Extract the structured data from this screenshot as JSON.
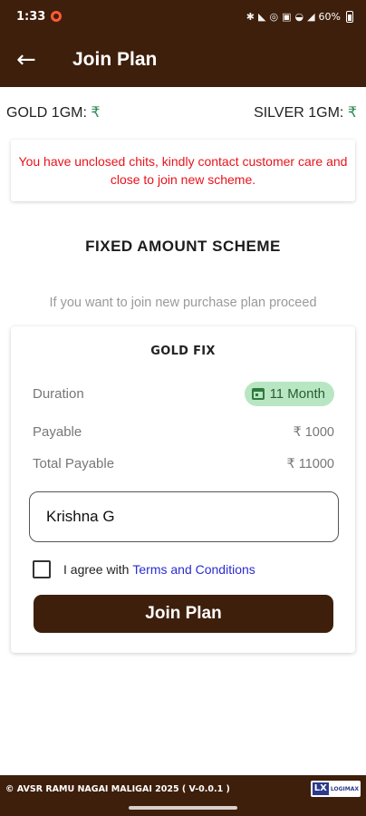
{
  "status": {
    "time": "1:33",
    "battery": "60%"
  },
  "appbar": {
    "title": "Join Plan"
  },
  "rates": {
    "gold_label": "GOLD 1GM:",
    "silver_label": "SILVER 1GM:",
    "currency": "₹"
  },
  "warning": {
    "message": "You have unclosed chits, kindly contact customer care and close to join new scheme."
  },
  "scheme": {
    "title": "FIXED AMOUNT SCHEME",
    "hint": "If you want to join new purchase plan proceed"
  },
  "plan": {
    "name": "GOLD FIX",
    "duration_label": "Duration",
    "duration_value": "11  Month",
    "payable_label": "Payable",
    "payable_value": "₹ 1000",
    "total_label": "Total Payable",
    "total_value": "₹ 11000"
  },
  "form": {
    "name_value": "Krishna G",
    "agree_text": "I agree with",
    "terms_link": "Terms and Conditions",
    "agree_checked": false,
    "join_button": "Join Plan"
  },
  "footer": {
    "copyright": "© AVSR RAMU NAGAI MALIGAI 2025 ( V-0.0.1 )",
    "logo_mark": "LX",
    "logo_text": "LOGIMAX"
  },
  "colors": {
    "brand": "#3e1f0b",
    "warning": "#e8131b",
    "link": "#2b2bd1",
    "badge_bg": "#b8e6c3"
  }
}
